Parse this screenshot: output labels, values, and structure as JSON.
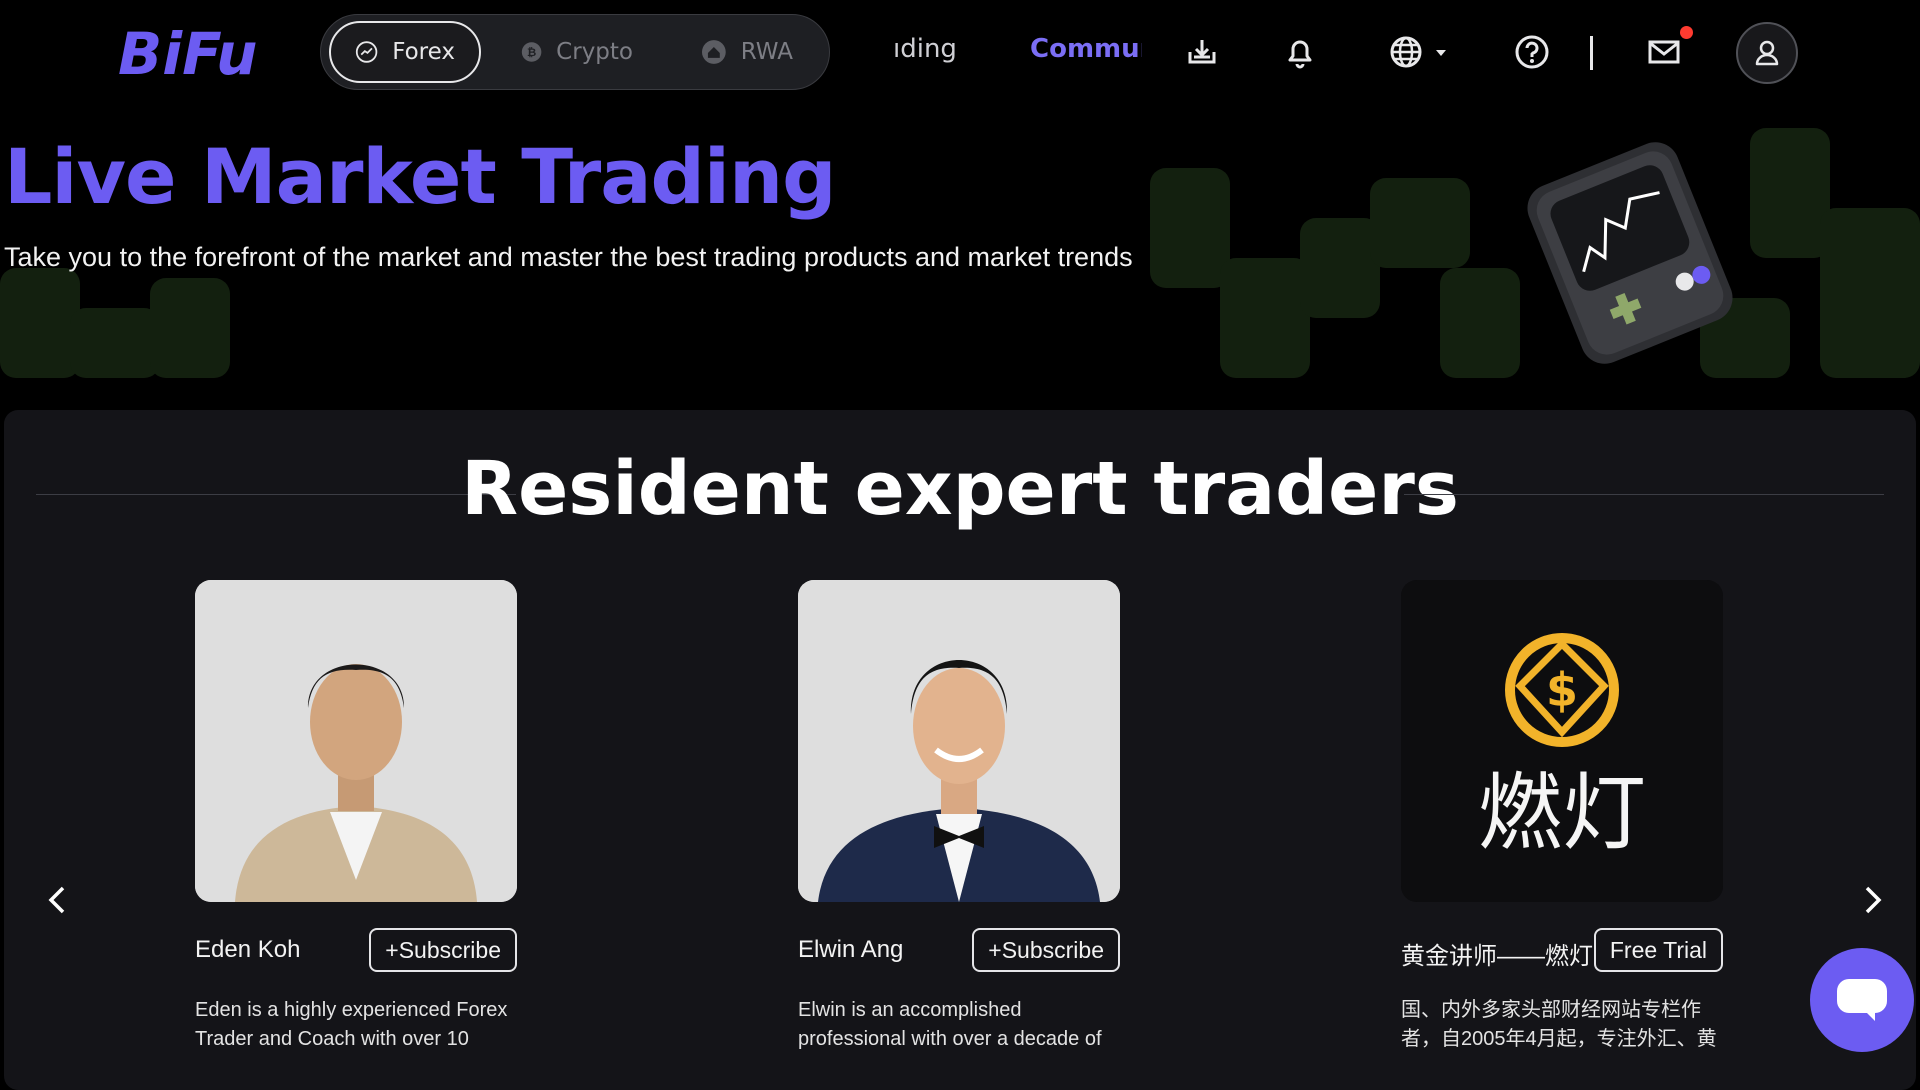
{
  "header": {
    "logo_text": "BiFu",
    "segments": [
      {
        "label": "Forex",
        "icon": "trend-chart-icon",
        "active": true
      },
      {
        "label": "Crypto",
        "icon": "bitcoin-icon",
        "active": false
      },
      {
        "label": "RWA",
        "icon": "home-coin-icon",
        "active": false
      }
    ],
    "nav_trading_label": "ıding",
    "nav_community_label": "Commun",
    "icons": [
      "download-icon",
      "bell-icon",
      "globe-icon",
      "chevron-down-icon",
      "help-icon",
      "mail-icon",
      "user-icon"
    ],
    "accent_color": "#6c5cf2"
  },
  "hero": {
    "title": "Live Market Trading",
    "subtitle": "Take you to the forefront of the market and master the best trading products and market trends"
  },
  "experts": {
    "section_title": "Resident expert traders",
    "cards": [
      {
        "name": "Eden Koh",
        "button": "+Subscribe",
        "description": "Eden is a highly experienced Forex Trader and Coach with over 10"
      },
      {
        "name": "Elwin Ang",
        "button": "+Subscribe",
        "description": "Elwin is an accomplished professional with over a decade of"
      },
      {
        "name": "黄金讲师——燃灯",
        "button": "Free Trial",
        "description": "国、内外多家头部财经网站专栏作者，自2005年4月起，专注外汇、黄",
        "logo_text": "燃灯"
      }
    ]
  }
}
